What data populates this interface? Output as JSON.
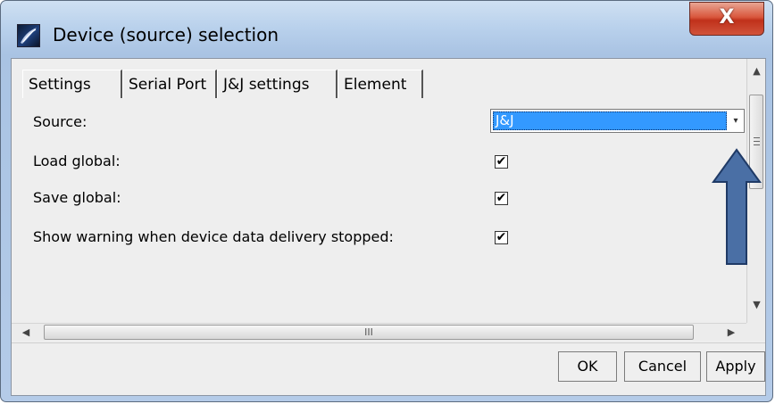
{
  "window": {
    "title": "Device (source) selection",
    "close_glyph": "X"
  },
  "tabs": [
    {
      "label": "Settings",
      "active": true
    },
    {
      "label": "Serial Port",
      "active": false
    },
    {
      "label": "J&J settings",
      "active": false
    },
    {
      "label": "Element",
      "active": false
    }
  ],
  "settings": {
    "source": {
      "label": "Source:",
      "value": "J&J"
    },
    "load_global": {
      "label": "Load global:",
      "checked": true
    },
    "save_global": {
      "label": "Save global:",
      "checked": true
    },
    "show_warning": {
      "label": "Show warning when device data delivery stopped:",
      "checked": true
    }
  },
  "check_glyph": "✔",
  "hscroll_grip": "III",
  "buttons": {
    "ok": "OK",
    "cancel": "Cancel",
    "apply": "Apply"
  },
  "colors": {
    "selection": "#3399ff",
    "annotation_arrow": "#4a6fa5",
    "close_button": "#c9432b"
  }
}
